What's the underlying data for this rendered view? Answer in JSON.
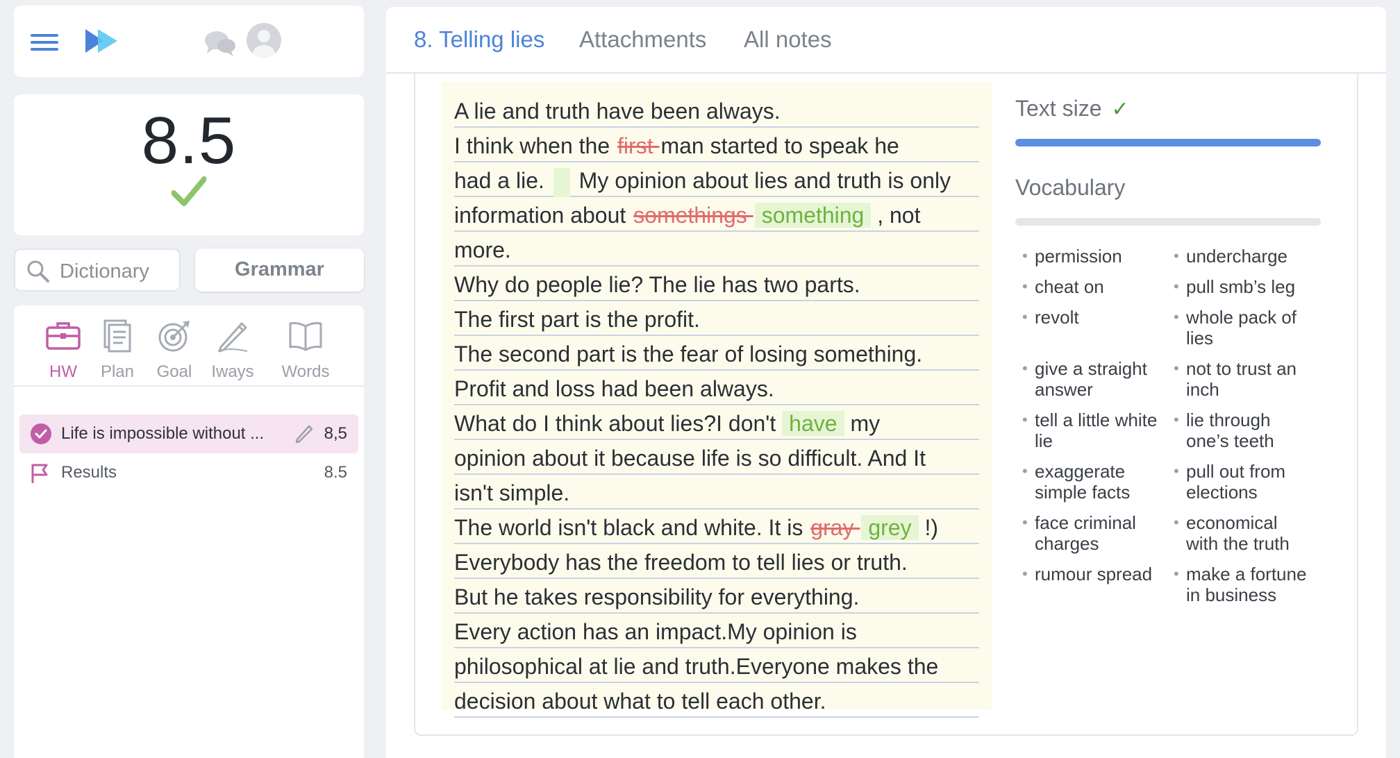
{
  "header": {
    "tabs": [
      {
        "label": "8. Telling lies",
        "active": true
      },
      {
        "label": "Attachments",
        "active": false
      },
      {
        "label": "All notes",
        "active": false
      }
    ]
  },
  "score": {
    "value": "8.5",
    "status": "passed"
  },
  "tools": {
    "dictionary_placeholder": "Dictionary",
    "grammar_label": "Grammar"
  },
  "nav": {
    "items": [
      {
        "label": "HW",
        "icon": "briefcase-icon",
        "active": true
      },
      {
        "label": "Plan",
        "icon": "document-icon",
        "active": false
      },
      {
        "label": "Goal",
        "icon": "target-icon",
        "active": false
      },
      {
        "label": "Iways",
        "icon": "pencil-icon",
        "active": false
      },
      {
        "label": "Words",
        "icon": "book-icon",
        "active": false
      }
    ]
  },
  "assignments": [
    {
      "title": "Life is impossible without ...",
      "score": "8,5",
      "selected": true
    },
    {
      "title": "Results",
      "score": "8.5",
      "selected": false
    }
  ],
  "essay": {
    "lines": [
      [
        {
          "t": "text",
          "v": " A lie and truth have been always."
        }
      ],
      [
        {
          "t": "text",
          "v": "I think when the "
        },
        {
          "t": "del",
          "v": "first "
        },
        {
          "t": "text",
          "v": " man started to speak he"
        }
      ],
      [
        {
          "t": "text",
          "v": "had a lie. "
        },
        {
          "t": "gap",
          "v": ""
        },
        {
          "t": "text",
          "v": " My opinion about lies and truth is only"
        }
      ],
      [
        {
          "t": "text",
          "v": "information about "
        },
        {
          "t": "del",
          "v": "somethings "
        },
        {
          "t": "ins",
          "v": "something"
        },
        {
          "t": "text",
          "v": " , not"
        }
      ],
      [
        {
          "t": "text",
          "v": "more."
        }
      ],
      [
        {
          "t": "text",
          "v": "Why do people lie? The lie has two parts."
        }
      ],
      [
        {
          "t": "text",
          "v": "The first part is the profit."
        }
      ],
      [
        {
          "t": "text",
          "v": "The second part is the fear of losing something."
        }
      ],
      [
        {
          "t": "text",
          "v": "Profit and loss had been always."
        }
      ],
      [
        {
          "t": "text",
          "v": "What do I think about lies?I don't "
        },
        {
          "t": "ins",
          "v": "have"
        },
        {
          "t": "text",
          "v": " my"
        }
      ],
      [
        {
          "t": "text",
          "v": "opinion about it because life is so difficult. And It"
        }
      ],
      [
        {
          "t": "text",
          "v": "isn't simple."
        }
      ],
      [
        {
          "t": "text",
          "v": "The world isn't black and white. It is "
        },
        {
          "t": "del",
          "v": "gray "
        },
        {
          "t": "ins",
          "v": "grey"
        },
        {
          "t": "text",
          "v": " !)"
        }
      ],
      [
        {
          "t": "text",
          "v": "Everybody has the freedom to tell lies or truth."
        }
      ],
      [
        {
          "t": "text",
          "v": "But he takes responsibility for everything."
        }
      ],
      [
        {
          "t": "text",
          "v": "Every action has an impact.My opinion is"
        }
      ],
      [
        {
          "t": "text",
          "v": "philosophical at lie and truth.Everyone makes the"
        }
      ],
      [
        {
          "t": "text",
          "v": "decision about what to tell each other."
        }
      ]
    ]
  },
  "sidebar": {
    "text_size_label": "Text size",
    "text_size_check": "✓",
    "vocabulary_label": "Vocabulary",
    "vocabulary": [
      [
        "permission",
        "undercharge"
      ],
      [
        "cheat on",
        "pull smb’s leg"
      ],
      [
        "revolt",
        "whole pack of lies"
      ],
      [
        "give a straight answer",
        "not to trust an inch"
      ],
      [
        "tell a little white lie",
        "lie through one’s teeth"
      ],
      [
        "exaggerate simple facts",
        "pull out from elections"
      ],
      [
        "face criminal charges",
        "economical with the truth"
      ],
      [
        "rumour spread",
        "make a fortune in business"
      ]
    ]
  },
  "colors": {
    "accent": "#4b83d8",
    "hw_active": "#c15ea5",
    "correct": "#6eb33f",
    "error": "#e06c6c"
  }
}
